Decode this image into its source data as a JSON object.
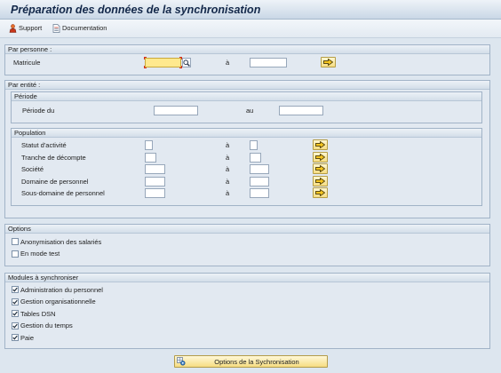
{
  "window": {
    "title": "Préparation des données de la synchronisation"
  },
  "toolbar": {
    "support": {
      "label": "Support",
      "icon": "support-icon"
    },
    "documentation": {
      "label": "Documentation",
      "icon": "documentation-icon"
    }
  },
  "par_personne": {
    "title": "Par personne :",
    "matricule": {
      "label": "Matricule",
      "from": "",
      "from_focused": true,
      "search_help_icon": "search-help-icon",
      "to_label": "à",
      "to": "",
      "multiple_selection_icon": "multiple-selection-arrow-icon"
    }
  },
  "par_entite": {
    "title": "Par entité :",
    "periode": {
      "title": "Période",
      "label": "Période du",
      "from": "",
      "to_label": "au",
      "to": ""
    },
    "population": {
      "title": "Population",
      "rows": [
        {
          "label": "Statut d'activité",
          "from": "",
          "to_label": "à",
          "to": ""
        },
        {
          "label": "Tranche de décompte",
          "from": "",
          "to_label": "à",
          "to": ""
        },
        {
          "label": "Société",
          "from": "",
          "to_label": "à",
          "to": ""
        },
        {
          "label": "Domaine de personnel",
          "from": "",
          "to_label": "à",
          "to": ""
        },
        {
          "label": "Sous-domaine de personnel",
          "from": "",
          "to_label": "à",
          "to": ""
        }
      ]
    }
  },
  "options": {
    "title": "Options",
    "items": [
      {
        "label": "Anonymisation des salariés",
        "checked": false
      },
      {
        "label": "En mode test",
        "checked": false
      }
    ]
  },
  "modules": {
    "title": "Modules à synchroniser",
    "items": [
      {
        "label": "Administration du personnel",
        "checked": true
      },
      {
        "label": "Gestion organisationnelle",
        "checked": true
      },
      {
        "label": "Tables DSN",
        "checked": true
      },
      {
        "label": "Gestion du temps",
        "checked": true
      },
      {
        "label": "Paie",
        "checked": true
      }
    ]
  },
  "sync_button": {
    "label": "Options de la Sychronisation",
    "icon": "options-icon"
  },
  "colors": {
    "page_background": "#dde6ef",
    "focused_field": "#ffe98e",
    "focus_marker": "#d62a1e",
    "pushbutton": "#f6dd82"
  }
}
